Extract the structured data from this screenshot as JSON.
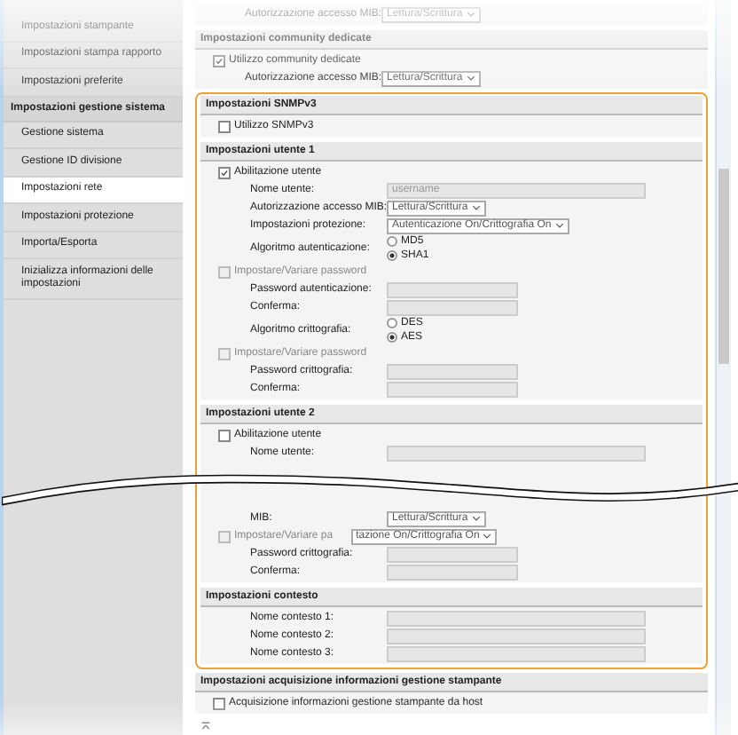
{
  "sidebar": {
    "items": [
      {
        "kind": "item",
        "label": "Impostazioni stampante",
        "selected": false
      },
      {
        "kind": "item",
        "label": "Impostazioni stampa rapporto",
        "selected": false
      },
      {
        "kind": "item",
        "label": "Impostazioni preferite",
        "selected": false
      },
      {
        "kind": "heading",
        "label": "Impostazioni gestione sistema"
      },
      {
        "kind": "item",
        "label": "Gestione sistema",
        "selected": false
      },
      {
        "kind": "item",
        "label": "Gestione ID divisione",
        "selected": false
      },
      {
        "kind": "item",
        "label": "Impostazioni rete",
        "selected": true
      },
      {
        "kind": "item",
        "label": "Impostazioni protezione",
        "selected": false
      },
      {
        "kind": "item",
        "label": "Importa/Esporta",
        "selected": false
      },
      {
        "kind": "item",
        "label": "Inizializza informazioni delle impostazioni",
        "selected": false
      }
    ]
  },
  "blocks": [
    {
      "kind": "plain",
      "sections": [
        {
          "rows": [
            {
              "kind": "select",
              "label": "Autorizzazione accesso MIB:",
              "value": "Lettura/Scrittura"
            }
          ]
        },
        {
          "title": "Impostazioni community dedicate",
          "rows": [
            {
              "kind": "checkbox",
              "label": "Utilizzo community dedicate",
              "checked": true,
              "disabled": false
            },
            {
              "kind": "select",
              "label": "Autorizzazione accesso MIB:",
              "value": "Lettura/Scrittura"
            }
          ]
        }
      ]
    },
    {
      "kind": "highlighted",
      "sections": [
        {
          "title": "Impostazioni SNMPv3",
          "rows": [
            {
              "kind": "checkbox",
              "label": "Utilizzo SNMPv3",
              "checked": false,
              "disabled": false
            }
          ]
        },
        {
          "title": "Impostazioni utente 1",
          "rows": [
            {
              "kind": "checkbox",
              "label": "Abilitazione utente",
              "checked": true,
              "disabled": false
            },
            {
              "kind": "text_field",
              "label": "Nome utente:",
              "placeholder": "username"
            },
            {
              "kind": "select",
              "label": "Autorizzazione accesso MIB:",
              "value": "Lettura/Scrittura"
            },
            {
              "kind": "select",
              "label": "Impostazioni protezione:",
              "value": "Autenticazione On/Crittografia On"
            },
            {
              "kind": "radio",
              "label": "Algoritmo autenticazione:",
              "options": [
                {
                  "label": "MD5",
                  "selected": false
                },
                {
                  "label": "SHA1",
                  "selected": true
                }
              ]
            },
            {
              "kind": "checkbox",
              "label": "Impostare/Variare password",
              "checked": false,
              "disabled": true
            },
            {
              "kind": "password_field",
              "label": "Password autenticazione:"
            },
            {
              "kind": "password_field",
              "label": "Conferma:"
            },
            {
              "kind": "radio",
              "label": "Algoritmo crittografia:",
              "options": [
                {
                  "label": "DES",
                  "selected": false
                },
                {
                  "label": "AES",
                  "selected": true
                }
              ]
            },
            {
              "kind": "checkbox",
              "label": "Impostare/Variare password",
              "checked": false,
              "disabled": true
            },
            {
              "kind": "password_field",
              "label": "Password crittografia:"
            },
            {
              "kind": "password_field",
              "label": "Conferma:"
            }
          ]
        },
        {
          "title": "Impostazioni utente 2",
          "rows": [
            {
              "kind": "checkbox",
              "label": "Abilitazione utente",
              "checked": false,
              "disabled": false
            },
            {
              "kind": "text_field",
              "label": "Nome utente:"
            },
            {
              "kind": "break"
            },
            {
              "kind": "select",
              "label": "MIB:",
              "value": "Lettura/Scrittura"
            },
            {
              "kind": "checkbox_select",
              "label": "Impostare/Variare pa",
              "checked": false,
              "disabled": true,
              "value": "tazione On/Crittografia On"
            },
            {
              "kind": "password_field",
              "label": "Password crittografia:"
            },
            {
              "kind": "password_field",
              "label": "Conferma:"
            }
          ]
        },
        {
          "title": "Impostazioni contesto",
          "rows": [
            {
              "kind": "text_field",
              "label": "Nome contesto 1:"
            },
            {
              "kind": "text_field",
              "label": "Nome contesto 2:"
            },
            {
              "kind": "text_field",
              "label": "Nome contesto 3:"
            }
          ]
        }
      ]
    },
    {
      "kind": "plain",
      "sections": [
        {
          "title": "Impostazioni acquisizione informazioni gestione stampante",
          "rows": [
            {
              "kind": "checkbox",
              "label": "Acquisizione informazioni gestione stampante da host",
              "checked": false,
              "disabled": false
            }
          ]
        }
      ]
    }
  ]
}
